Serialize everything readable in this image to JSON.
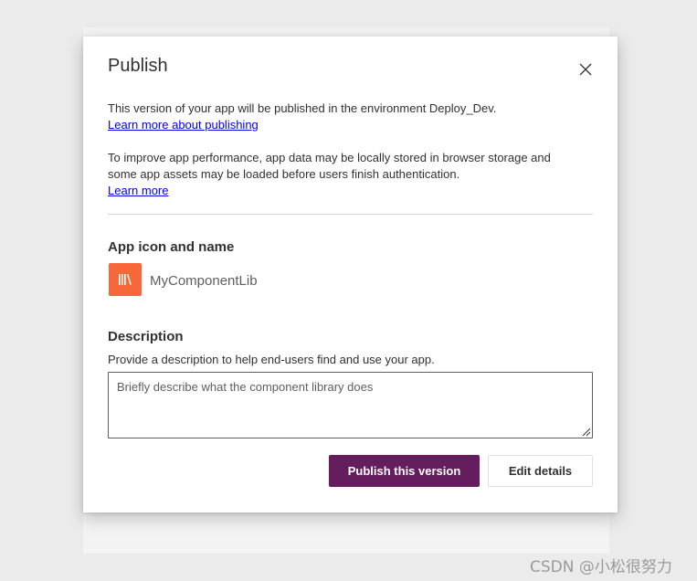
{
  "dialog": {
    "title": "Publish",
    "close_icon": "close-icon"
  },
  "intro": {
    "text": "This version of your app will be published in the environment Deploy_Dev.",
    "link": "Learn more about publishing"
  },
  "performance": {
    "text": "To improve app performance, app data may be locally stored in browser storage and some app assets may be loaded before users finish authentication.",
    "link": "Learn more"
  },
  "app": {
    "section_label": "App icon and name",
    "icon": "library-books-icon",
    "icon_color": "#f7673a",
    "name": "MyComponentLib"
  },
  "description": {
    "section_label": "Description",
    "help": "Provide a description to help end-users find and use your app.",
    "value": "",
    "placeholder": "Briefly describe what the component library does"
  },
  "actions": {
    "publish_label": "Publish this version",
    "publish_color": "#641e5e",
    "edit_label": "Edit details"
  },
  "watermark": "CSDN @小松很努力"
}
